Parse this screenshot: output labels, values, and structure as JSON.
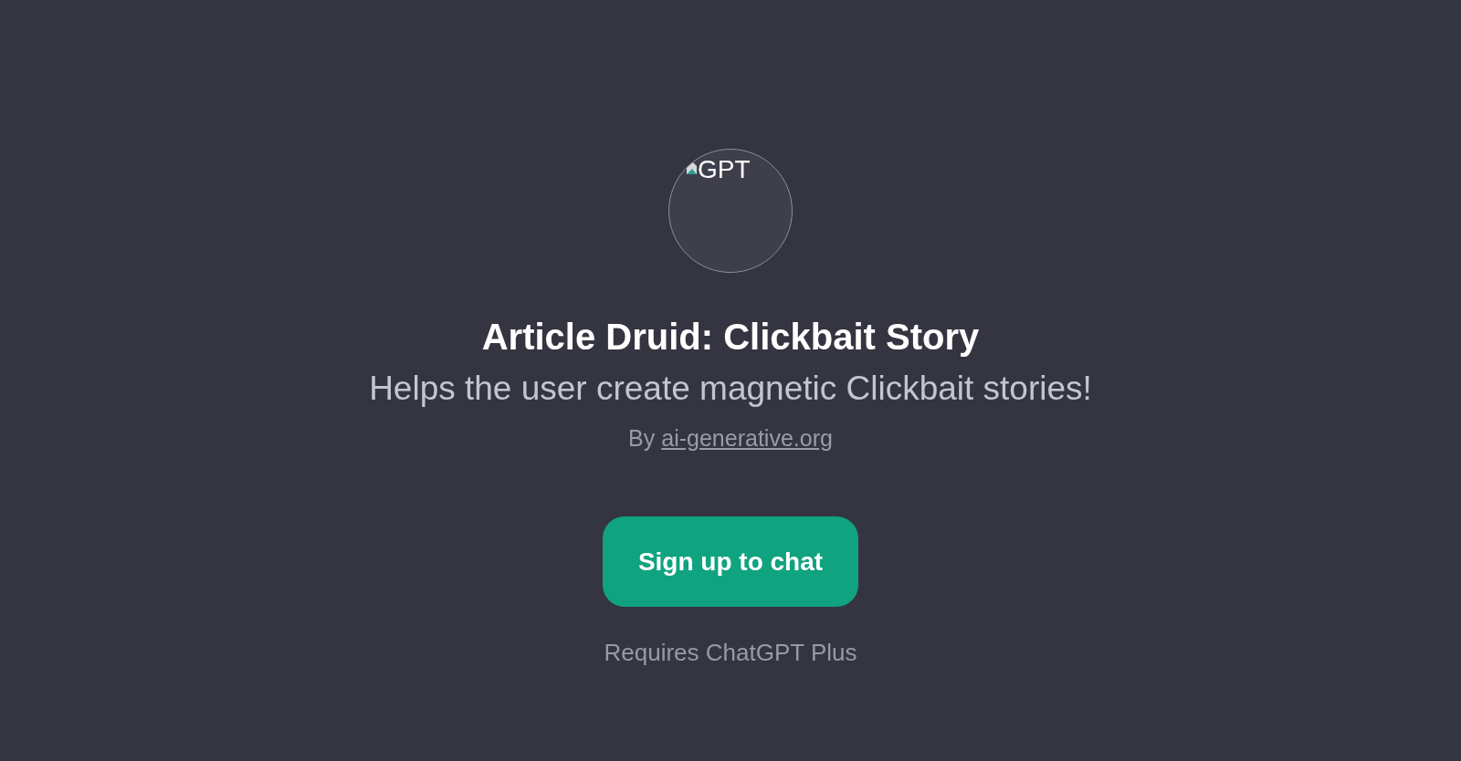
{
  "avatar": {
    "alt_text": "GPT"
  },
  "title": "Article Druid: Clickbait Story",
  "description": "Helps the user create magnetic Clickbait stories!",
  "author": {
    "prefix": "By",
    "link": "ai-generative.org"
  },
  "signup_button": "Sign up to chat",
  "requirement_note": "Requires ChatGPT Plus"
}
